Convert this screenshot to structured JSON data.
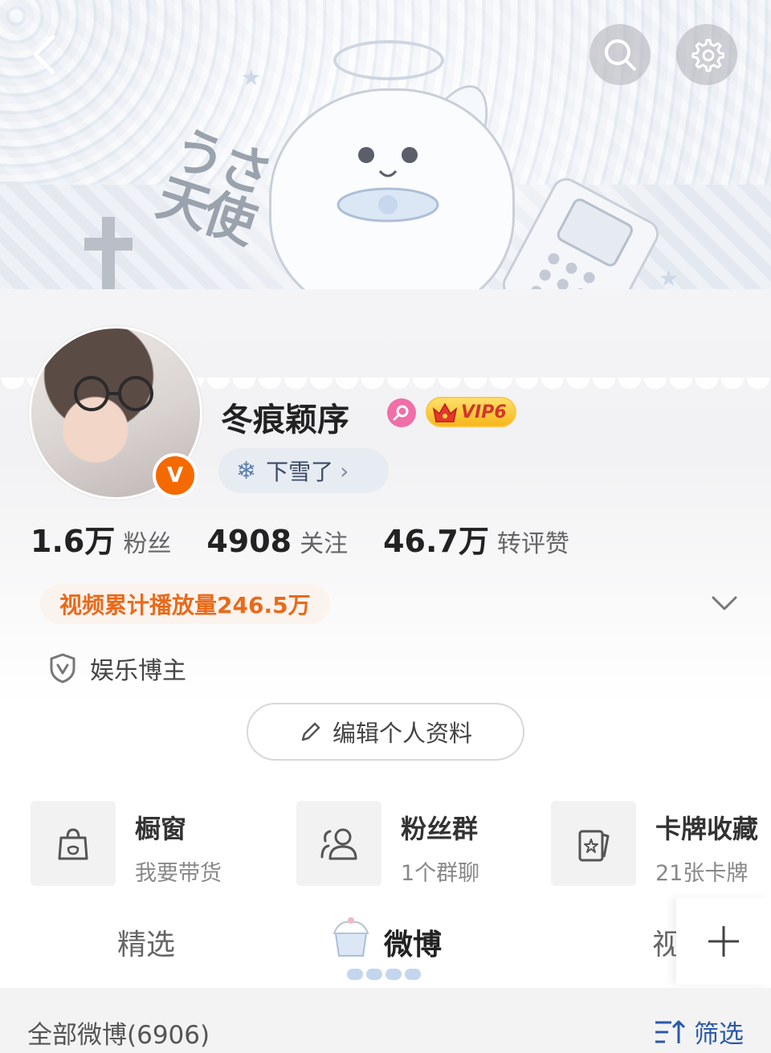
{
  "profile": {
    "name": "冬痕颖序",
    "vip_label": "VIP6",
    "verified_mark": "V",
    "status_label": "下雪了",
    "status_icon": "❄",
    "status_chevron": "›"
  },
  "stats": [
    {
      "value": "1.6万",
      "label": "粉丝"
    },
    {
      "value": "4908",
      "label": "关注"
    },
    {
      "value": "46.7万",
      "label": "转评赞"
    }
  ],
  "video_plays": "视频累计播放量246.5万",
  "role_label": "娱乐博主",
  "edit_profile_label": "编辑个人资料",
  "shortcuts": [
    {
      "title": "橱窗",
      "subtitle": "我要带货",
      "icon": "shopping-bag-icon"
    },
    {
      "title": "粉丝群",
      "subtitle": "1个群聊",
      "icon": "group-icon"
    },
    {
      "title": "卡牌收藏",
      "subtitle": "21张卡牌",
      "icon": "card-icon"
    }
  ],
  "tabs": [
    {
      "label": "精选"
    },
    {
      "label": "微博"
    },
    {
      "label": "视"
    }
  ],
  "posts_header": {
    "all_label": "全部微博(6906)",
    "filter_label": "筛选"
  },
  "colors": {
    "accent_orange": "#e96a1a",
    "verified_orange": "#f56a00",
    "link_blue": "#2a5aa8",
    "vip_gold": "#f7b61b",
    "female_pink": "#f06fa8"
  }
}
